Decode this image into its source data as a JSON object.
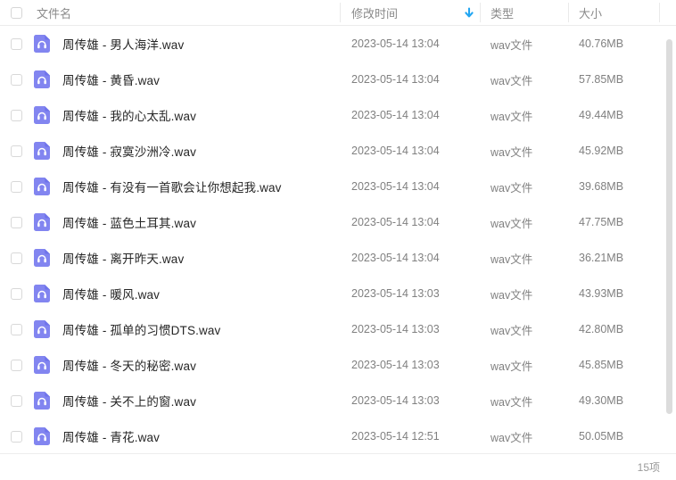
{
  "accent": {
    "icon_purple": "#8285f0",
    "icon_purple_dark": "#6f73ea",
    "sort_blue": "#22a6f2",
    "text_primary": "#262626",
    "text_secondary": "#808080",
    "header_text": "#8a8a8a",
    "border": "#ececec"
  },
  "header": {
    "select_all_checkbox": "",
    "columns": [
      {
        "key": "name",
        "label": "文件名"
      },
      {
        "key": "mtime",
        "label": "修改时间"
      },
      {
        "key": "type",
        "label": "类型"
      },
      {
        "key": "size",
        "label": "大小"
      }
    ],
    "sort": {
      "column": "修改时间",
      "direction": "descending",
      "icon": "arrow-down-icon"
    }
  },
  "rows": [
    {
      "icon": "audio-file-icon",
      "name": "周传雄 - 男人海洋.wav",
      "mtime": "2023-05-14 13:04",
      "type": "wav文件",
      "size": "40.76MB",
      "checked": false
    },
    {
      "icon": "audio-file-icon",
      "name": "周传雄 - 黄昏.wav",
      "mtime": "2023-05-14 13:04",
      "type": "wav文件",
      "size": "57.85MB",
      "checked": false
    },
    {
      "icon": "audio-file-icon",
      "name": "周传雄 - 我的心太乱.wav",
      "mtime": "2023-05-14 13:04",
      "type": "wav文件",
      "size": "49.44MB",
      "checked": false
    },
    {
      "icon": "audio-file-icon",
      "name": "周传雄 - 寂寞沙洲冷.wav",
      "mtime": "2023-05-14 13:04",
      "type": "wav文件",
      "size": "45.92MB",
      "checked": false
    },
    {
      "icon": "audio-file-icon",
      "name": "周传雄 - 有没有一首歌会让你想起我.wav",
      "mtime": "2023-05-14 13:04",
      "type": "wav文件",
      "size": "39.68MB",
      "checked": false
    },
    {
      "icon": "audio-file-icon",
      "name": "周传雄 - 蓝色土耳其.wav",
      "mtime": "2023-05-14 13:04",
      "type": "wav文件",
      "size": "47.75MB",
      "checked": false
    },
    {
      "icon": "audio-file-icon",
      "name": "周传雄 - 离开昨天.wav",
      "mtime": "2023-05-14 13:04",
      "type": "wav文件",
      "size": "36.21MB",
      "checked": false
    },
    {
      "icon": "audio-file-icon",
      "name": "周传雄 - 暖风.wav",
      "mtime": "2023-05-14 13:03",
      "type": "wav文件",
      "size": "43.93MB",
      "checked": false
    },
    {
      "icon": "audio-file-icon",
      "name": "周传雄 - 孤单的习惯DTS.wav",
      "mtime": "2023-05-14 13:03",
      "type": "wav文件",
      "size": "42.80MB",
      "checked": false
    },
    {
      "icon": "audio-file-icon",
      "name": "周传雄 - 冬天的秘密.wav",
      "mtime": "2023-05-14 13:03",
      "type": "wav文件",
      "size": "45.85MB",
      "checked": false
    },
    {
      "icon": "audio-file-icon",
      "name": "周传雄 - 关不上的窗.wav",
      "mtime": "2023-05-14 13:03",
      "type": "wav文件",
      "size": "49.30MB",
      "checked": false
    },
    {
      "icon": "audio-file-icon",
      "name": "周传雄 - 青花.wav",
      "mtime": "2023-05-14 12:51",
      "type": "wav文件",
      "size": "50.05MB",
      "checked": false
    }
  ],
  "footer": {
    "count_label": "15项"
  }
}
